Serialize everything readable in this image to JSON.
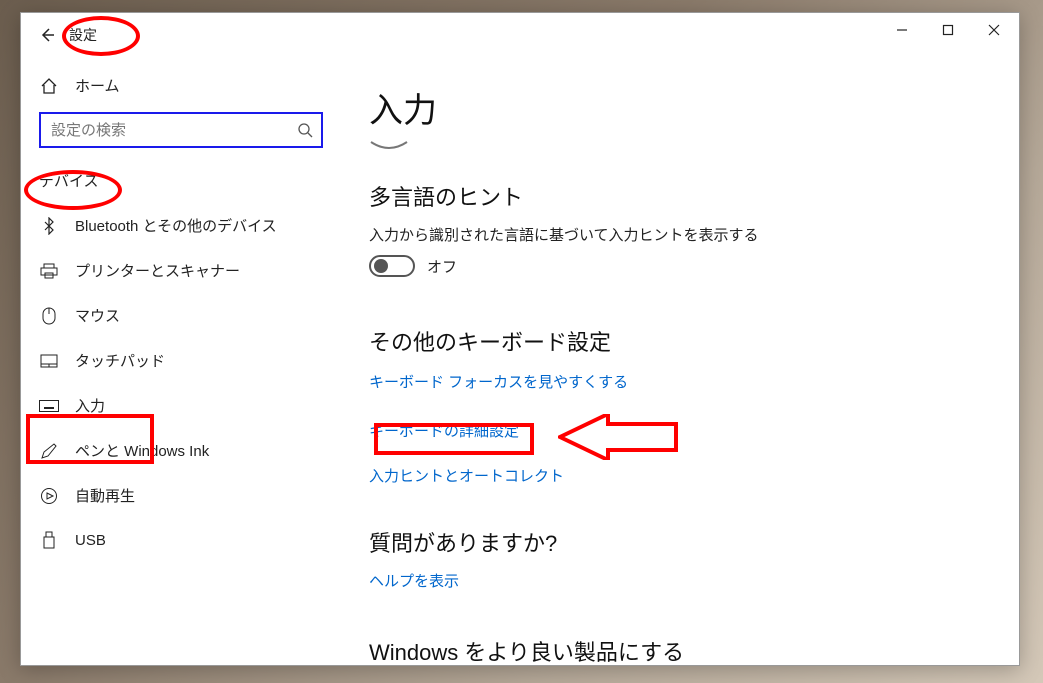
{
  "window": {
    "title": "設定",
    "controls": {
      "min": "min",
      "max": "max",
      "close": "close"
    }
  },
  "sidebar": {
    "home": "ホーム",
    "search_placeholder": "設定の検索",
    "category": "デバイス",
    "items": [
      {
        "icon": "bluetooth-icon",
        "label": "Bluetooth とその他のデバイス"
      },
      {
        "icon": "printer-icon",
        "label": "プリンターとスキャナー"
      },
      {
        "icon": "mouse-icon",
        "label": "マウス"
      },
      {
        "icon": "touchpad-icon",
        "label": "タッチパッド"
      },
      {
        "icon": "keyboard-icon",
        "label": "入力"
      },
      {
        "icon": "pen-icon",
        "label": "ペンと Windows Ink"
      },
      {
        "icon": "autoplay-icon",
        "label": "自動再生"
      },
      {
        "icon": "usb-icon",
        "label": "USB"
      }
    ]
  },
  "content": {
    "page_title": "入力",
    "sections": {
      "multilang": {
        "title": "多言語のヒント",
        "desc": "入力から識別された言語に基づいて入力ヒントを表示する",
        "toggle_state": "off",
        "toggle_label": "オフ"
      },
      "other_keyboard": {
        "title": "その他のキーボード設定",
        "links": [
          "キーボード フォーカスを見やすくする",
          "キーボードの詳細設定",
          "入力ヒントとオートコレクト"
        ]
      },
      "help": {
        "title": "質問がありますか?",
        "link": "ヘルプを表示"
      },
      "feedback": {
        "title": "Windows をより良い製品にする"
      }
    }
  }
}
